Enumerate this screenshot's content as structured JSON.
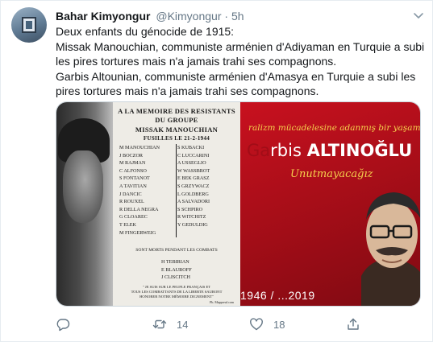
{
  "tweet": {
    "author_name": "Bahar Kimyongur",
    "handle": "@Kimyongur",
    "separator": "·",
    "time": "5h",
    "text_lines": [
      "Deux enfants du génocide de 1915:",
      "Missak Manouchian, communiste arménien d'Adiyaman en Turquie a subi les pires tortures mais n'a jamais trahi ses compagnons.",
      "Garbis Altounian, communiste arménien d'Amasya en Turquie a subi les pires tortures mais n'a jamais trahi ses compagnons."
    ]
  },
  "image": {
    "document": {
      "heading1": "A LA MEMOIRE DES RESISTANTS",
      "heading2": "DU GROUPE",
      "heading3": "MISSAK MANOUCHIAN",
      "heading4": "FUSILLES LE 21-2-1944",
      "left_names": [
        "M MANOUCHIAN",
        "J BOCZOR",
        "M RAJMAN",
        "C ALFONSO",
        "S FONTANOT",
        "A TAVITIAN",
        "J DANCIC",
        "R ROUXEL",
        "R DELLA NEGRA",
        "G CLOAREC",
        "T ELEK",
        "M FINGERWEIG"
      ],
      "right_names": [
        "S KUBACKI",
        "C LUCCARINI",
        "A USSEGLIO",
        "W WASSBROT",
        "E BEK GRASZ",
        "S GRZYWACZ",
        "L GOLDBERG",
        "A SALVADORI",
        "S SCHPIRO",
        "R WITCHITZ",
        "Y GEDULDIG"
      ],
      "combat_line": "SONT MORTS PENDANT LES COMBATS",
      "combat_names": [
        "H TEBIRIAN",
        "E BLAUROFF",
        "J CLISCITCH"
      ],
      "footer_line1": "\" JE SUIS SUR LE PEUPLE FRANÇAIS ET",
      "footer_line2": "TOUS LES COMBATTANTS DE LA LIBERTE SAURONT",
      "footer_line3": "HONORER NOTRE MÉMOIRE DIGNEMENT\"",
      "credit": "Ph. Mappreuf.com"
    },
    "poster": {
      "slogan": "ralizm mücadelesine adanmış bir yaşam",
      "name_first": "rbis",
      "name_first_prefix": "Ga",
      "name_last": "ALTINOĞLU",
      "forget": "Unutmayacağız",
      "years": "1946 / ...2019",
      "accent_color": "#f6d24d",
      "background_color": "#b50f1b"
    }
  },
  "actions": {
    "reply_count": "",
    "retweet_count": "14",
    "like_count": "18"
  },
  "colors": {
    "text": "#14171a",
    "muted": "#657786",
    "border": "#e6ecf0"
  }
}
